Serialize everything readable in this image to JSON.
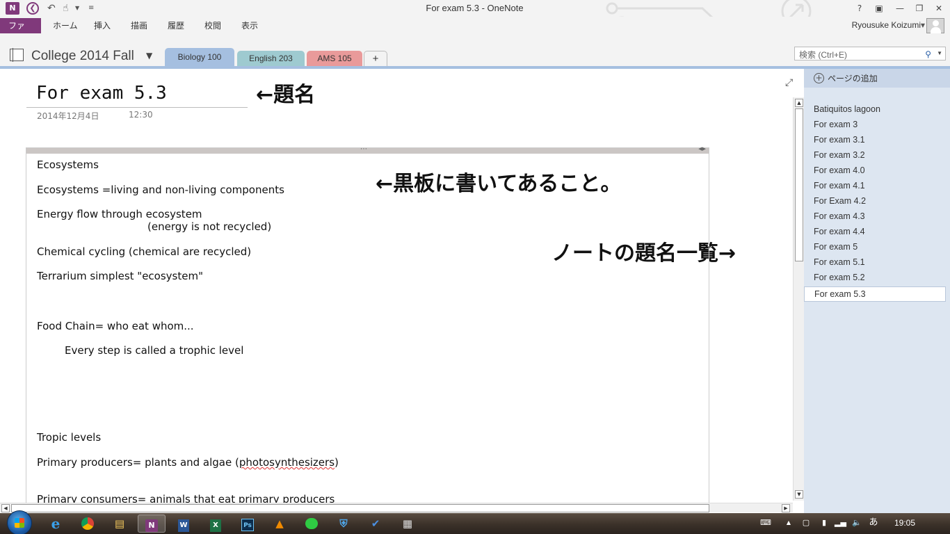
{
  "window": {
    "title": "For exam 5.3 - OneNote"
  },
  "ribbon": {
    "tabs": [
      "ファイル",
      "ホーム",
      "挿入",
      "描画",
      "履歴",
      "校閲",
      "表示"
    ],
    "user": "Ryousuke Koizumi"
  },
  "notebook": {
    "name": "College 2014 Fall",
    "sections": [
      "Biology 100",
      "English 203",
      "AMS 105",
      "+"
    ],
    "search_placeholder": "検索 (Ctrl+E)"
  },
  "page": {
    "title": "For exam 5.3",
    "date": "2014年12月4日",
    "time": "12:30",
    "annotations": {
      "title": "←題名",
      "board": "←黒板に書いてあること。",
      "list": "ノートの題名一覧→"
    },
    "lines": [
      "Ecosystems",
      "Ecosystems =living and non-living components",
      "Energy flow through ecosystem",
      "(energy is not recycled)",
      "Chemical cycling (chemical are recycled)",
      "Terrarium simplest \"ecosystem\"",
      "Food Chain= who eat whom...",
      "Every step is called a trophic level",
      "Tropic levels",
      "Primary producers= plants and algae (",
      "photosynthesizers",
      ")",
      "Primary consumers= animals that eat primary producers"
    ]
  },
  "pagelist": {
    "add_label": "ページの追加",
    "pages": [
      "Batiquitos lagoon",
      "For exam 3",
      "For exam 3.1",
      "For exam 3.2",
      "For exam 4.0",
      "For exam 4.1",
      "For Exam 4.2",
      "For exam 4.3",
      "For exam 4.4",
      "For exam 5",
      "For exam 5.1",
      "For exam 5.2",
      "For exam 5.3"
    ],
    "active_index": 12
  },
  "taskbar": {
    "clock": "19:05",
    "ime": "あ",
    "colors": {
      "onenote": "#80397b",
      "accent": "#a5bfe0"
    }
  }
}
